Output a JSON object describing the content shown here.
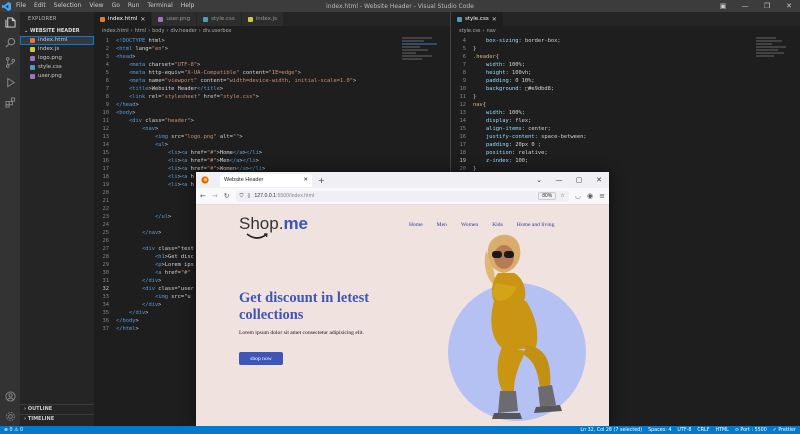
{
  "titlebar": {
    "menus": [
      "File",
      "Edit",
      "Selection",
      "View",
      "Go",
      "Run",
      "Terminal",
      "Help"
    ],
    "title": "index.html - Website Header - Visual Studio Code"
  },
  "sidebar": {
    "header": "EXPLORER",
    "project": "WEBSITE HEADER",
    "files": [
      {
        "name": "index.html",
        "color": "#e37933"
      },
      {
        "name": "index.js",
        "color": "#cbcb41"
      },
      {
        "name": "logo.png",
        "color": "#a074c4"
      },
      {
        "name": "style.css",
        "color": "#519aba"
      },
      {
        "name": "user.png",
        "color": "#a074c4"
      }
    ],
    "outline": "OUTLINE",
    "timeline": "TIMELINE"
  },
  "editor": {
    "tabs_left": [
      {
        "name": "index.html",
        "active": true,
        "color": "#e37933"
      },
      {
        "name": "user.png",
        "active": false,
        "color": "#a074c4"
      },
      {
        "name": "style.css",
        "active": false,
        "color": "#519aba"
      },
      {
        "name": "index.js",
        "active": false,
        "color": "#cbcb41"
      }
    ],
    "breadcrumb_left": [
      "index.html",
      "html",
      "body",
      "div.header",
      "div.userbox"
    ],
    "left_lines": [
      {
        "n": "1",
        "t": "<!DOCTYPE html>"
      },
      {
        "n": "2",
        "t": "<html lang=\"en\">"
      },
      {
        "n": "3",
        "t": "<head>"
      },
      {
        "n": "4",
        "t": "    <meta charset=\"UTF-8\">"
      },
      {
        "n": "5",
        "t": "    <meta http-equiv=\"X-UA-Compatible\" content=\"IE=edge\">"
      },
      {
        "n": "6",
        "t": "    <meta name=\"viewport\" content=\"width=device-width, initial-scale=1.0\">"
      },
      {
        "n": "7",
        "t": "    <title>Website Header</title>"
      },
      {
        "n": "8",
        "t": "    <link rel=\"stylesheet\" href=\"style.css\">"
      },
      {
        "n": "9",
        "t": "</head>"
      },
      {
        "n": "10",
        "t": "<body>"
      },
      {
        "n": "11",
        "t": "    <div class=\"header\">"
      },
      {
        "n": "12",
        "t": "        <nav>"
      },
      {
        "n": "13",
        "t": "            <img src=\"logo.png\" alt=\"\">"
      },
      {
        "n": "14",
        "t": "            <ul>"
      },
      {
        "n": "15",
        "t": "                <li><a href=\"#\">Home</a></li>"
      },
      {
        "n": "16",
        "t": "                <li><a href=\"#\">Men</a></li>"
      },
      {
        "n": "17",
        "t": "                <li><a href=\"#\">Women</a></li>"
      },
      {
        "n": "18",
        "t": "                <li><a h"
      },
      {
        "n": "19",
        "t": "                <li><a h"
      },
      {
        "n": "20",
        "t": ""
      },
      {
        "n": "21",
        "t": ""
      },
      {
        "n": "22",
        "t": ""
      },
      {
        "n": "23",
        "t": "            </ul>"
      },
      {
        "n": "24",
        "t": ""
      },
      {
        "n": "25",
        "t": "        </nav>"
      },
      {
        "n": "26",
        "t": ""
      },
      {
        "n": "27",
        "t": "        <div class=\"text"
      },
      {
        "n": "28",
        "t": "            <h1>Get disc"
      },
      {
        "n": "29",
        "t": "            <p>Lorem ips"
      },
      {
        "n": "30",
        "t": "            <a href=\"#\""
      },
      {
        "n": "31",
        "t": "        </div>"
      },
      {
        "n": "32",
        "t": "        <div class=\"user"
      },
      {
        "n": "33",
        "t": "            <img src=\"u"
      },
      {
        "n": "34",
        "t": "        </div>"
      },
      {
        "n": "35",
        "t": "    </div>"
      },
      {
        "n": "36",
        "t": "</body>"
      },
      {
        "n": "37",
        "t": "</html>"
      }
    ],
    "tabs_right": [
      {
        "name": "style.css",
        "active": true,
        "color": "#519aba"
      }
    ],
    "breadcrumb_right": [
      "style.css",
      "nav"
    ],
    "right_lines": [
      {
        "n": "4",
        "t": "    box-sizing: border-box;"
      },
      {
        "n": "5",
        "t": "}"
      },
      {
        "n": "6",
        "t": ".header{"
      },
      {
        "n": "7",
        "t": "    width: 100%;"
      },
      {
        "n": "8",
        "t": "    height: 100vh;"
      },
      {
        "n": "9",
        "t": "    padding: 0 10%;"
      },
      {
        "n": "10",
        "t": "    background: □#e9dbd8;"
      },
      {
        "n": "11",
        "t": "}"
      },
      {
        "n": "12",
        "t": "nav{"
      },
      {
        "n": "13",
        "t": "    width: 100%;"
      },
      {
        "n": "14",
        "t": "    display: flex;"
      },
      {
        "n": "15",
        "t": "    align-items: center;"
      },
      {
        "n": "16",
        "t": "    justify-content: space-between;"
      },
      {
        "n": "17",
        "t": "    padding: 20px 0 ;"
      },
      {
        "n": "18",
        "t": "    position: relative;"
      },
      {
        "n": "19",
        "t": "    z-index: 100;"
      },
      {
        "n": "20",
        "t": "}"
      }
    ]
  },
  "browser": {
    "tab_title": "Website Header",
    "url_host": "127.0.0.1",
    "url_rest": ":5500/index.html",
    "zoom": "80%"
  },
  "site": {
    "logo_main": "Shop.",
    "logo_accent": "me",
    "nav": [
      "Home",
      "Men",
      "Women",
      "Kids",
      "Home and living"
    ],
    "heading": "Get discount in letest collections",
    "lorem": "Lorem ipsum dolor sit amet consectetur adipisicing elit.",
    "button": "shop now"
  },
  "status": {
    "left": [
      "⊗ 0 ⚠ 0"
    ],
    "right": [
      "Ln 32, Col 28 (7 selected)",
      "Spaces: 4",
      "UTF-8",
      "CRLF",
      "HTML",
      "⊙ Port : 5500",
      "✓ Prettier"
    ]
  },
  "colors": {
    "accent": "#3f55b8",
    "statusbar": "#007acc",
    "page_bg": "#efe2df",
    "circle": "#b5c1f2"
  }
}
